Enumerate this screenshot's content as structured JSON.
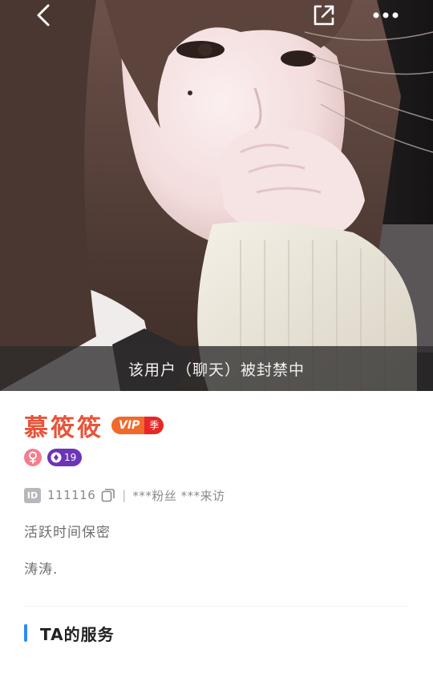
{
  "header": {
    "back_icon": "chevron-left-icon",
    "share_icon": "share-external-icon",
    "more_icon": "more-dots-icon"
  },
  "photo": {
    "ban_notice": "该用户（聊天）被封禁中"
  },
  "profile": {
    "username": "慕筱筱",
    "vip_label": "VIP",
    "vip_season": "季",
    "gender_icon": "female-icon",
    "level": "19",
    "id_label": "ID",
    "id_value": "111116",
    "separator": "|",
    "stats": "***粉丝 ***来访",
    "activity": "活跃时间保密",
    "signature": "涛涛."
  },
  "services": {
    "title": "TA的服务"
  },
  "colors": {
    "username": "#e8543a",
    "vip": "#f06a2c",
    "season": "#e62828",
    "gender": "#f37e8e",
    "level": "#6b35b6",
    "accent": "#2b8ef0"
  }
}
